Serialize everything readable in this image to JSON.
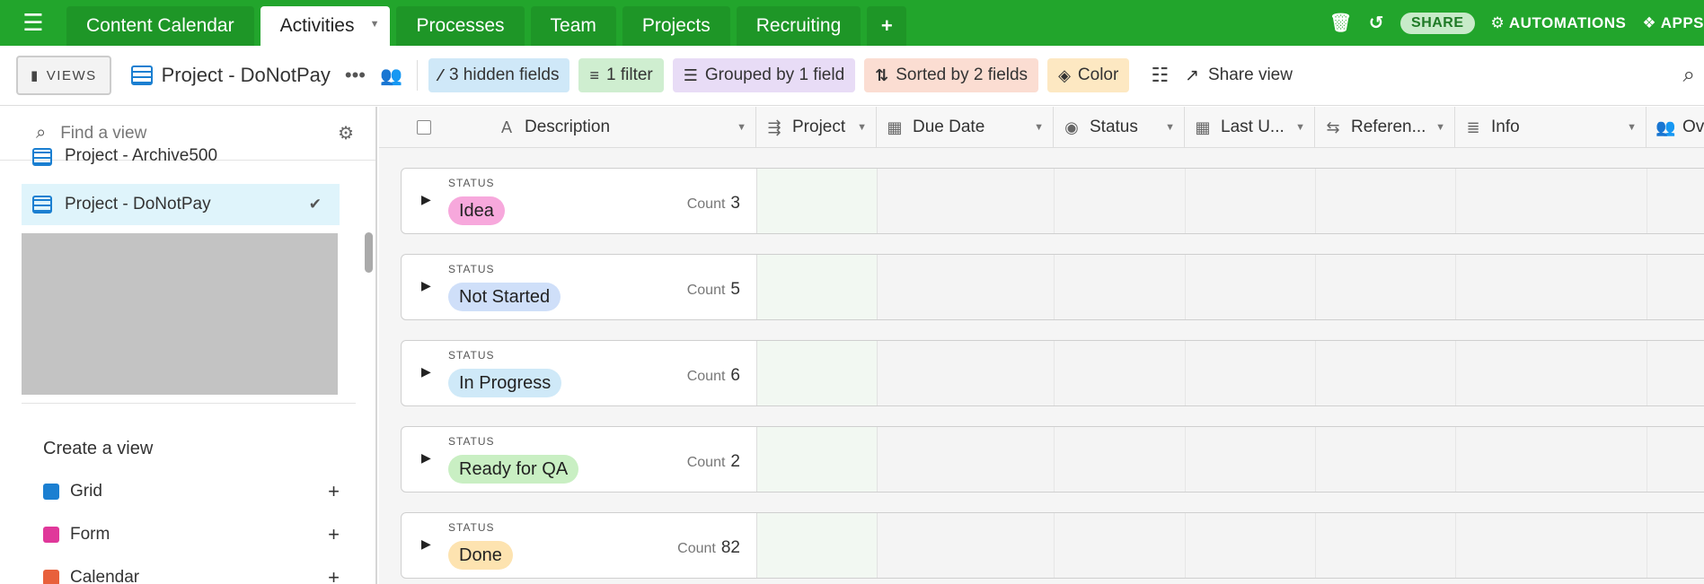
{
  "tabs": [
    {
      "label": "Content Calendar",
      "active": false
    },
    {
      "label": "Activities",
      "active": true
    },
    {
      "label": "Processes",
      "active": false
    },
    {
      "label": "Team",
      "active": false
    },
    {
      "label": "Projects",
      "active": false
    },
    {
      "label": "Recruiting",
      "active": false
    }
  ],
  "topbar": {
    "share_label": "SHARE",
    "automations_label": "AUTOMATIONS",
    "apps_label": "APPS"
  },
  "toolbar": {
    "views_label": "VIEWS",
    "view_title": "Project - DoNotPay",
    "hidden_fields": "3 hidden fields",
    "filter": "1 filter",
    "grouped": "Grouped by 1 field",
    "sorted": "Sorted by 2 fields",
    "color": "Color",
    "share_view": "Share view"
  },
  "sidebar": {
    "search_placeholder": "Find a view",
    "views": [
      "Project - Archive500",
      "Project - DoNotPay"
    ],
    "create_label": "Create a view",
    "create_items": [
      {
        "label": "Grid",
        "color": "#1b7fd1"
      },
      {
        "label": "Form",
        "color": "#e0389a"
      },
      {
        "label": "Calendar",
        "color": "#e8603c"
      }
    ]
  },
  "columns": [
    "Description",
    "Project",
    "Due Date",
    "Status",
    "Last U...",
    "Referen...",
    "Info",
    "Ov"
  ],
  "groups": [
    {
      "label": "STATUS",
      "value": "Idea",
      "count_label": "Count",
      "count": "3",
      "color": "#f7a8dc"
    },
    {
      "label": "STATUS",
      "value": "Not Started",
      "count_label": "Count",
      "count": "5",
      "color": "#cfdff9"
    },
    {
      "label": "STATUS",
      "value": "In Progress",
      "count_label": "Count",
      "count": "6",
      "color": "#cfe9f8"
    },
    {
      "label": "STATUS",
      "value": "Ready for QA",
      "count_label": "Count",
      "count": "2",
      "color": "#c9efc3"
    },
    {
      "label": "STATUS",
      "value": "Done",
      "count_label": "Count",
      "count": "82",
      "color": "#fde3b0"
    }
  ]
}
